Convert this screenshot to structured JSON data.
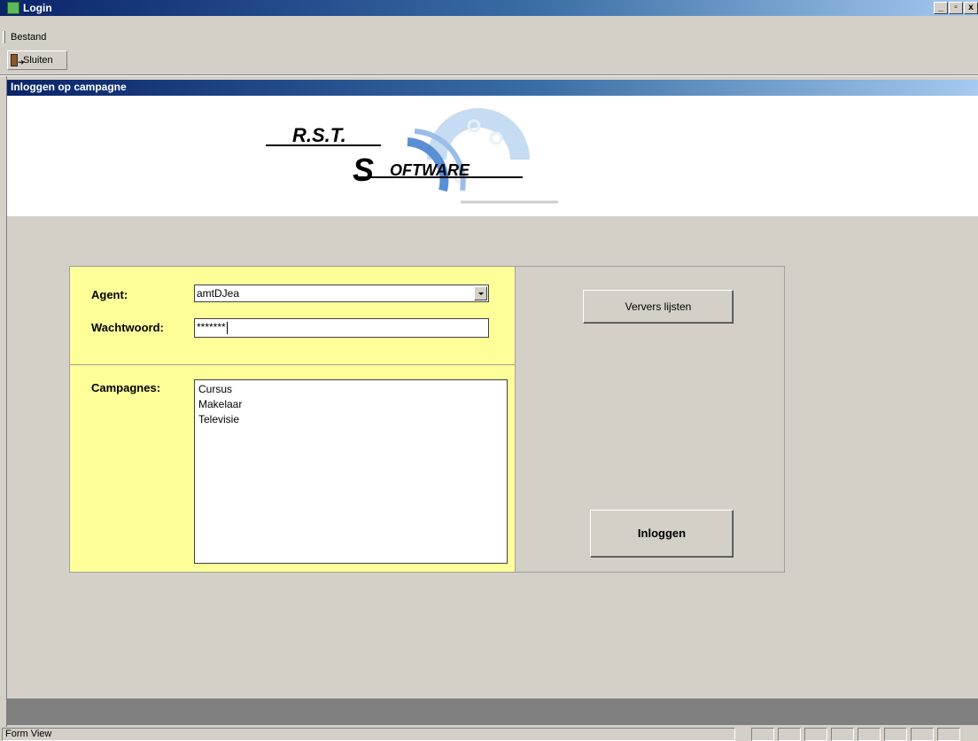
{
  "window": {
    "title": "Login",
    "buttons": [
      "_",
      "▫",
      "x"
    ]
  },
  "menubar": {
    "items": [
      "Bestand"
    ]
  },
  "toolbar": {
    "close_label": "Sluiten"
  },
  "form": {
    "header": "Inloggen op campagne",
    "logo": {
      "line1": "R.S.T.",
      "line2_initial": "S",
      "line2_rest": "OFTWARE"
    },
    "agent": {
      "label": "Agent:",
      "value": "amtDJea"
    },
    "password": {
      "label": "Wachtwoord:",
      "value": "*******"
    },
    "campaigns": {
      "label": "Campagnes:",
      "items": [
        "Cursus",
        "Makelaar",
        "Televisie"
      ]
    },
    "refresh_button": "Ververs lijsten",
    "login_button": "Inloggen"
  },
  "statusbar": {
    "text": "Form View"
  },
  "colors": {
    "panel_yellow": "#ffff99",
    "window_bg": "#d4d0c8",
    "title_dark": "#0a246a"
  }
}
